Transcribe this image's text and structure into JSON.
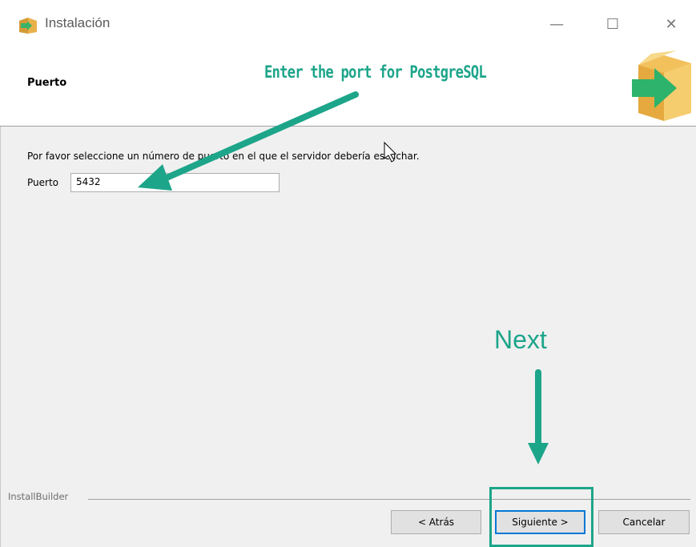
{
  "window": {
    "title": "Instalación",
    "minimize_glyph": "—",
    "maximize_glyph": "☐",
    "close_glyph": "✕"
  },
  "header": {
    "title": "Puerto"
  },
  "content": {
    "prompt": "Por favor seleccione un número de puerto en el que el servidor debería escuchar.",
    "port_label": "Puerto",
    "port_value": "5432"
  },
  "footer": {
    "brand": "InstallBuilder",
    "back_label": "< Atrás",
    "next_label": "Siguiente >",
    "cancel_label": "Cancelar"
  },
  "annotations": {
    "port_hint": "Enter the port for PostgreSQL",
    "next_hint": "Next",
    "color": "#1da58a"
  },
  "icons": {
    "app": "box-arrow-icon",
    "logo": "box-arrow-icon"
  }
}
